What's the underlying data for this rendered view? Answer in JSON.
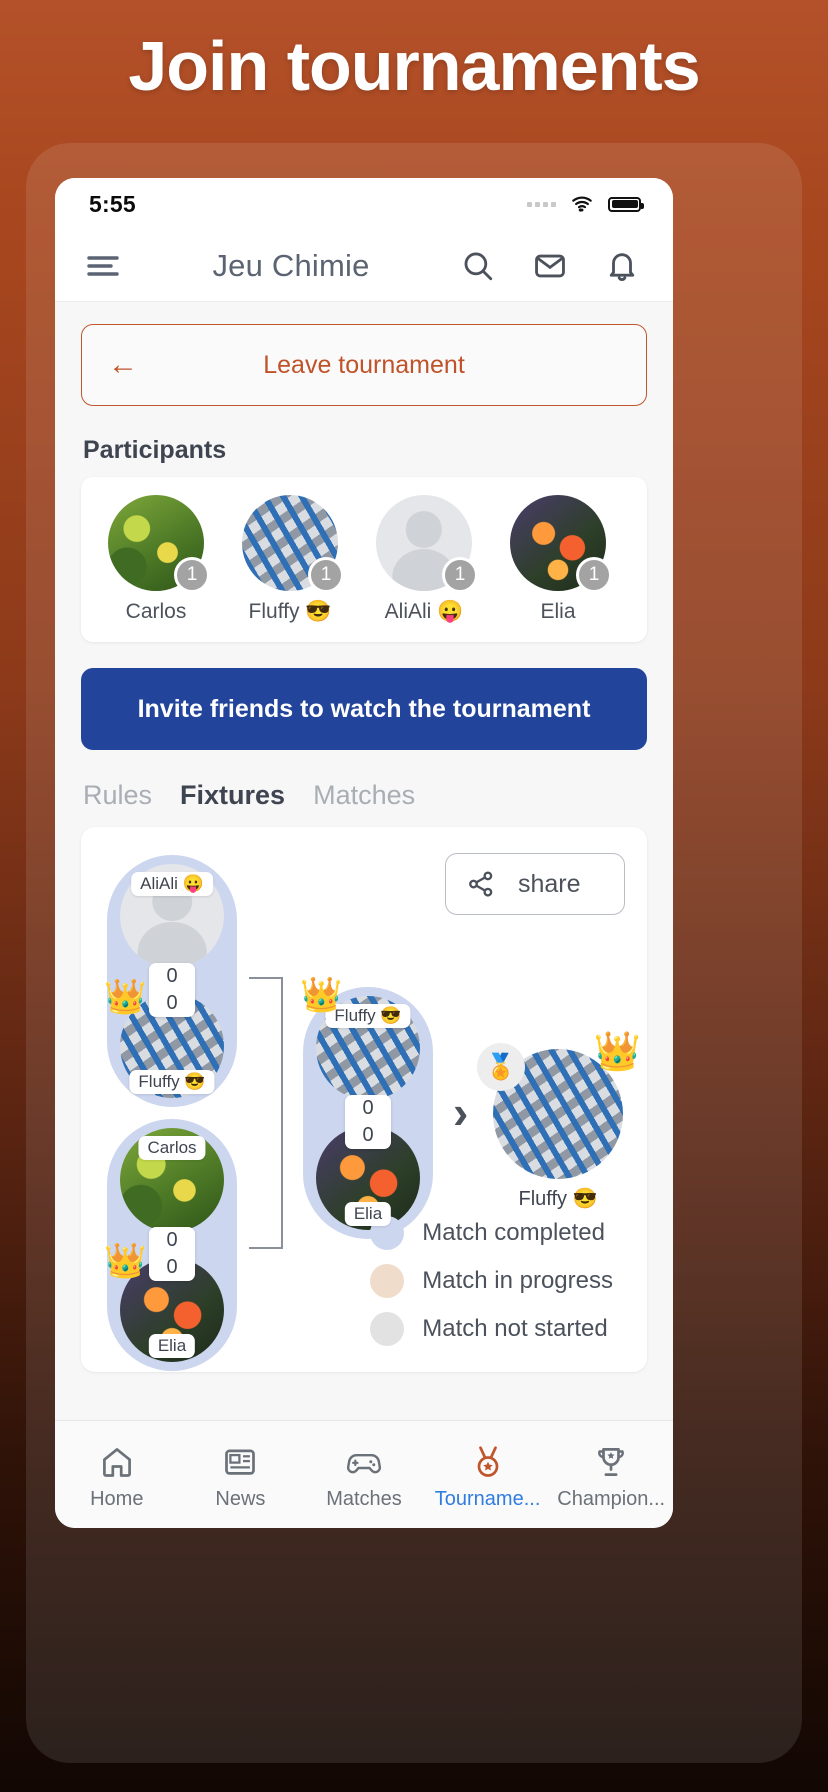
{
  "promo": {
    "title": "Join tournaments"
  },
  "status_bar": {
    "time": "5:55",
    "wifi_icon": "wifi-icon",
    "battery_icon": "battery-icon",
    "signal_icon": "signal-dots-icon"
  },
  "app_bar": {
    "title": "Jeu Chimie",
    "menu_icon": "hamburger-menu-icon",
    "search_icon": "search-icon",
    "mail_icon": "mail-icon",
    "bell_icon": "bell-icon"
  },
  "leave_button": {
    "label": "Leave tournament",
    "icon": "arrow-left-icon",
    "color": "#bf5229"
  },
  "participants": {
    "title": "Participants",
    "items": [
      {
        "name": "Carlos",
        "badge": "1",
        "avatar": "leaf-photo"
      },
      {
        "name": "Fluffy 😎",
        "badge": "1",
        "avatar": "collage-photo"
      },
      {
        "name": "AliAli 😛",
        "badge": "1",
        "avatar": "default-person-photo"
      },
      {
        "name": "Elia",
        "badge": "1",
        "avatar": "flower-photo"
      }
    ]
  },
  "invite_button": {
    "label": "Invite friends to watch the tournament",
    "color": "#22449a"
  },
  "tabs": [
    {
      "label": "Rules",
      "active": false
    },
    {
      "label": "Fixtures",
      "active": true
    },
    {
      "label": "Matches",
      "active": false
    }
  ],
  "bracket": {
    "share_button": {
      "label": "share",
      "icon": "share-nodes-icon"
    },
    "round1": [
      {
        "top": {
          "name": "AliAli 😛",
          "score": "0",
          "avatar": "default-person-photo",
          "crown": false
        },
        "bottom": {
          "name": "Fluffy 😎",
          "score": "0",
          "avatar": "collage-photo",
          "crown": true
        },
        "state": "completed"
      },
      {
        "top": {
          "name": "Carlos",
          "score": "0",
          "avatar": "leaf-photo",
          "crown": false
        },
        "bottom": {
          "name": "Elia",
          "score": "0",
          "avatar": "flower-photo",
          "crown": true
        },
        "state": "completed"
      }
    ],
    "round2": [
      {
        "top": {
          "name": "Fluffy 😎",
          "score": "0",
          "avatar": "collage-photo",
          "crown": true
        },
        "bottom": {
          "name": "Elia",
          "score": "0",
          "avatar": "flower-photo",
          "crown": false
        },
        "state": "completed"
      }
    ],
    "winner": {
      "name": "Fluffy 😎",
      "avatar": "collage-photo",
      "medal_icon": "medal-icon",
      "crown": true
    },
    "advance_icon": "chevron-right-icon",
    "legend": [
      {
        "label": "Match completed",
        "color": "#ccd6ef"
      },
      {
        "label": "Match in progress",
        "color": "#f0dccb"
      },
      {
        "label": "Match not started",
        "color": "#e2e2e2"
      }
    ]
  },
  "bottom_nav": [
    {
      "label": "Home",
      "icon": "home-icon",
      "active": false
    },
    {
      "label": "News",
      "icon": "news-icon",
      "active": false
    },
    {
      "label": "Matches",
      "icon": "gamepad-icon",
      "active": false
    },
    {
      "label": "Tourname...",
      "icon": "medal-icon",
      "active": true
    },
    {
      "label": "Champion...",
      "icon": "trophy-icon",
      "active": false
    }
  ]
}
